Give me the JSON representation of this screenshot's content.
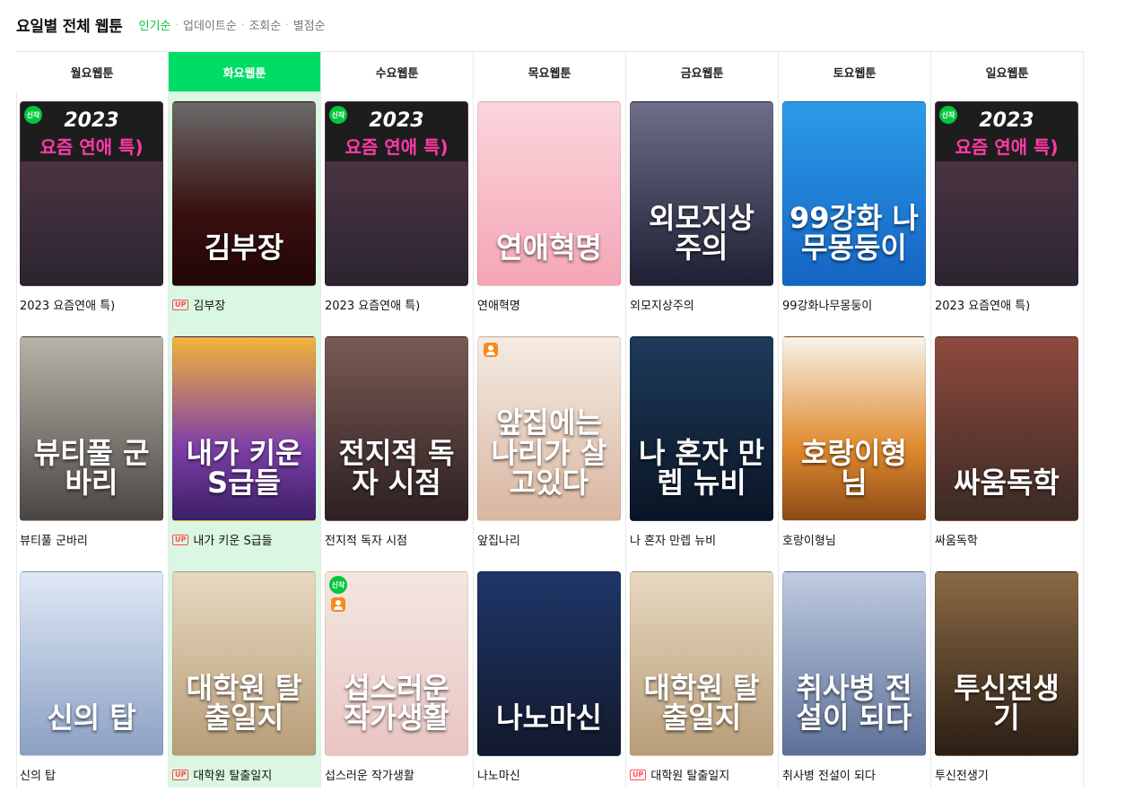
{
  "header": {
    "title": "요일별 전체 웹툰",
    "sorts": [
      "인기순",
      "업데이트순",
      "조회순",
      "별점순"
    ],
    "sort_separator": "·",
    "active_sort": "인기순"
  },
  "colors": {
    "accent": "#00dc64",
    "active_column_bg": "#d9f7e2",
    "sort_active": "#00c73c",
    "up_badge": "#ff4d4d"
  },
  "columns": [
    {
      "day": "월요웹툰",
      "active": false,
      "items": [
        {
          "title": "2023 요즘연애 특)",
          "thumb_text": "",
          "top_year": "2023",
          "top_sub": "요즘 연애 특)",
          "up": false,
          "new": true,
          "person": false,
          "bg": "linear-gradient(180deg,#5a3a4a 0%,#2b2530 100%)"
        },
        {
          "title": "뷰티풀 군바리",
          "thumb_text": "뷰티풀 군바리",
          "up": false,
          "new": false,
          "person": false,
          "bg": "linear-gradient(180deg,#b7b3a8 0%,#4a4543 100%)"
        },
        {
          "title": "신의 탑",
          "thumb_text": "신의 탑",
          "up": false,
          "new": false,
          "person": false,
          "bg": "linear-gradient(180deg,#dfe8f5 0%,#8ba0c4 100%)"
        }
      ]
    },
    {
      "day": "화요웹툰",
      "active": true,
      "items": [
        {
          "title": "김부장",
          "thumb_text": "김부장",
          "up": true,
          "new": false,
          "person": false,
          "bg": "linear-gradient(180deg,#6b6b6b 0%,#3a1010 60%,#210606 100%)"
        },
        {
          "title": "내가 키운 S급들",
          "thumb_text": "내가 키운 S급들",
          "up": true,
          "new": false,
          "person": false,
          "bg": "linear-gradient(180deg,#f3b43a 0%,#7d3fa8 60%,#3b1f66 100%)"
        },
        {
          "title": "대학원 탈출일지",
          "thumb_text": "대학원 탈출일지",
          "up": true,
          "new": false,
          "person": false,
          "bg": "linear-gradient(180deg,#e7d8c0 0%,#b89d78 100%)"
        }
      ]
    },
    {
      "day": "수요웹툰",
      "active": false,
      "items": [
        {
          "title": "2023 요즘연애 특)",
          "thumb_text": "",
          "top_year": "2023",
          "top_sub": "요즘 연애 특)",
          "up": false,
          "new": true,
          "person": false,
          "bg": "linear-gradient(180deg,#5a3a4a 0%,#2b2530 100%)"
        },
        {
          "title": "전지적 독자 시점",
          "thumb_text": "전지적 독자 시점",
          "up": false,
          "new": false,
          "person": false,
          "bg": "linear-gradient(180deg,#7a5a52 0%,#2c2022 100%)"
        },
        {
          "title": "섭스러운 작가생활",
          "thumb_text": "섭스러운 작가생활",
          "up": false,
          "new": true,
          "person": true,
          "bg": "linear-gradient(180deg,#f3e7df 0%,#e9c4c3 100%)"
        }
      ]
    },
    {
      "day": "목요웹툰",
      "active": false,
      "items": [
        {
          "title": "연애혁명",
          "thumb_text": "연애혁명",
          "up": false,
          "new": false,
          "person": false,
          "bg": "linear-gradient(180deg,#fbd6dc 0%,#f4a5b6 100%)"
        },
        {
          "title": "앞집나리",
          "thumb_text": "앞집에는 나리가 살고있다",
          "up": false,
          "new": false,
          "person": true,
          "bg": "linear-gradient(180deg,#f4ebe2 0%,#d9b6a0 100%)"
        },
        {
          "title": "나노마신",
          "thumb_text": "나노마신",
          "up": false,
          "new": false,
          "person": false,
          "bg": "linear-gradient(180deg,#1f3668 0%,#12192c 100%)"
        }
      ]
    },
    {
      "day": "금요웹툰",
      "active": false,
      "items": [
        {
          "title": "외모지상주의",
          "thumb_text": "외모지상주의",
          "up": false,
          "new": false,
          "person": false,
          "bg": "linear-gradient(180deg,#6d6f8a 0%,#1e1f33 100%)"
        },
        {
          "title": "나 혼자 만렙 뉴비",
          "thumb_text": "나 혼자 만렙 뉴비",
          "up": false,
          "new": false,
          "person": false,
          "bg": "linear-gradient(180deg,#1d3b5a 0%,#0b1425 100%)"
        },
        {
          "title": "대학원 탈출일지",
          "thumb_text": "대학원 탈출일지",
          "up": true,
          "new": false,
          "person": false,
          "bg": "linear-gradient(180deg,#e7d8c0 0%,#b89d78 100%)"
        }
      ]
    },
    {
      "day": "토요웹툰",
      "active": false,
      "items": [
        {
          "title": "99강화나무몽둥이",
          "thumb_text": "99강화 나무몽둥이",
          "up": false,
          "new": false,
          "person": false,
          "bg": "linear-gradient(180deg,#2b9be8 0%,#1564c4 100%)"
        },
        {
          "title": "호랑이형님",
          "thumb_text": "호랑이형님",
          "up": false,
          "new": false,
          "person": false,
          "bg": "linear-gradient(180deg,#f7f3ea 0%,#e08a2e 60%,#8b4b18 100%)"
        },
        {
          "title": "취사병 전설이 되다",
          "thumb_text": "취사병 전설이 되다",
          "up": false,
          "new": false,
          "person": false,
          "bg": "linear-gradient(180deg,#bfcbe0 0%,#5d7098 100%)"
        }
      ]
    },
    {
      "day": "일요웹툰",
      "active": false,
      "items": [
        {
          "title": "2023 요즘연애 특)",
          "thumb_text": "",
          "top_year": "2023",
          "top_sub": "요즘 연애 특)",
          "up": false,
          "new": true,
          "person": false,
          "bg": "linear-gradient(180deg,#5a3a4a 0%,#2b2530 100%)"
        },
        {
          "title": "싸움독학",
          "thumb_text": "싸움독학",
          "up": false,
          "new": false,
          "person": false,
          "bg": "linear-gradient(180deg,#8e4a3e 0%,#3a2a24 100%)"
        },
        {
          "title": "투신전생기",
          "thumb_text": "투신전생기",
          "up": false,
          "new": false,
          "person": false,
          "bg": "linear-gradient(180deg,#8a6a44 0%,#2a1e14 100%)"
        }
      ]
    }
  ]
}
